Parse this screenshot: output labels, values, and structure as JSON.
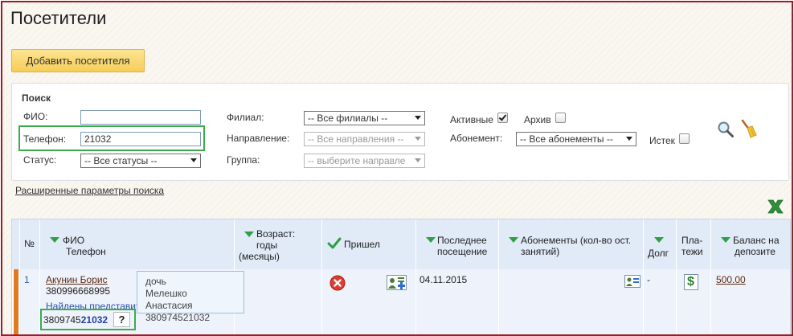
{
  "page": {
    "title": "Посетители"
  },
  "actions": {
    "add_visitor": "Добавить посетителя"
  },
  "search": {
    "title": "Поиск",
    "fio_label": "ФИО:",
    "fio_value": "",
    "phone_label": "Телефон:",
    "phone_value": "21032",
    "status_label": "Статус:",
    "status_value": "-- Все статусы --",
    "branch_label": "Филиал:",
    "branch_value": "-- Все филиалы --",
    "direction_label": "Направление:",
    "direction_value": "-- Все направления --",
    "group_label": "Группа:",
    "group_value": "-- выберите направле",
    "active_label": "Активные",
    "active_checked": true,
    "archive_label": "Архив",
    "archive_checked": false,
    "subscription_label": "Абонемент:",
    "subscription_value": "-- Все абонементы --",
    "expired_label": "Истек",
    "expired_checked": false,
    "advanced_link": "Расширенные параметры поиска"
  },
  "table": {
    "headers": {
      "num": "№",
      "fio": "ФИО",
      "phone": "Телефон",
      "age_1": "Возраст:",
      "age_2": "годы",
      "age_3": "(месяцы)",
      "came": "Пришел",
      "last_visit_1": "Последнее",
      "last_visit_2": "посещение",
      "subs_1": "Абонементы (кол-во ост.",
      "subs_2": "занятий)",
      "debt": "Долг",
      "pay_1": "Пла-",
      "pay_2": "тежи",
      "balance_1": "Баланс на",
      "balance_2": "депозите"
    },
    "rows": [
      {
        "num": "1",
        "name": "Акунин Борис",
        "phone": "380996668995",
        "found_reps": "Найдены представит",
        "rep_phone_prefix": "3809745",
        "rep_phone_match": "21032",
        "help": "?",
        "last_visit": "04.11.2015",
        "debt": "-",
        "payments_icon": "$",
        "balance": "500.00"
      }
    ]
  },
  "tooltip": {
    "relation": "дочь",
    "name": "Мелешко Анастасия",
    "phone": "380974521032"
  },
  "colors": {
    "accent_green": "#3cab4c",
    "frame": "#9b1d27",
    "row_marker": "#e07b22",
    "button_yellow": "#f8d76e"
  }
}
